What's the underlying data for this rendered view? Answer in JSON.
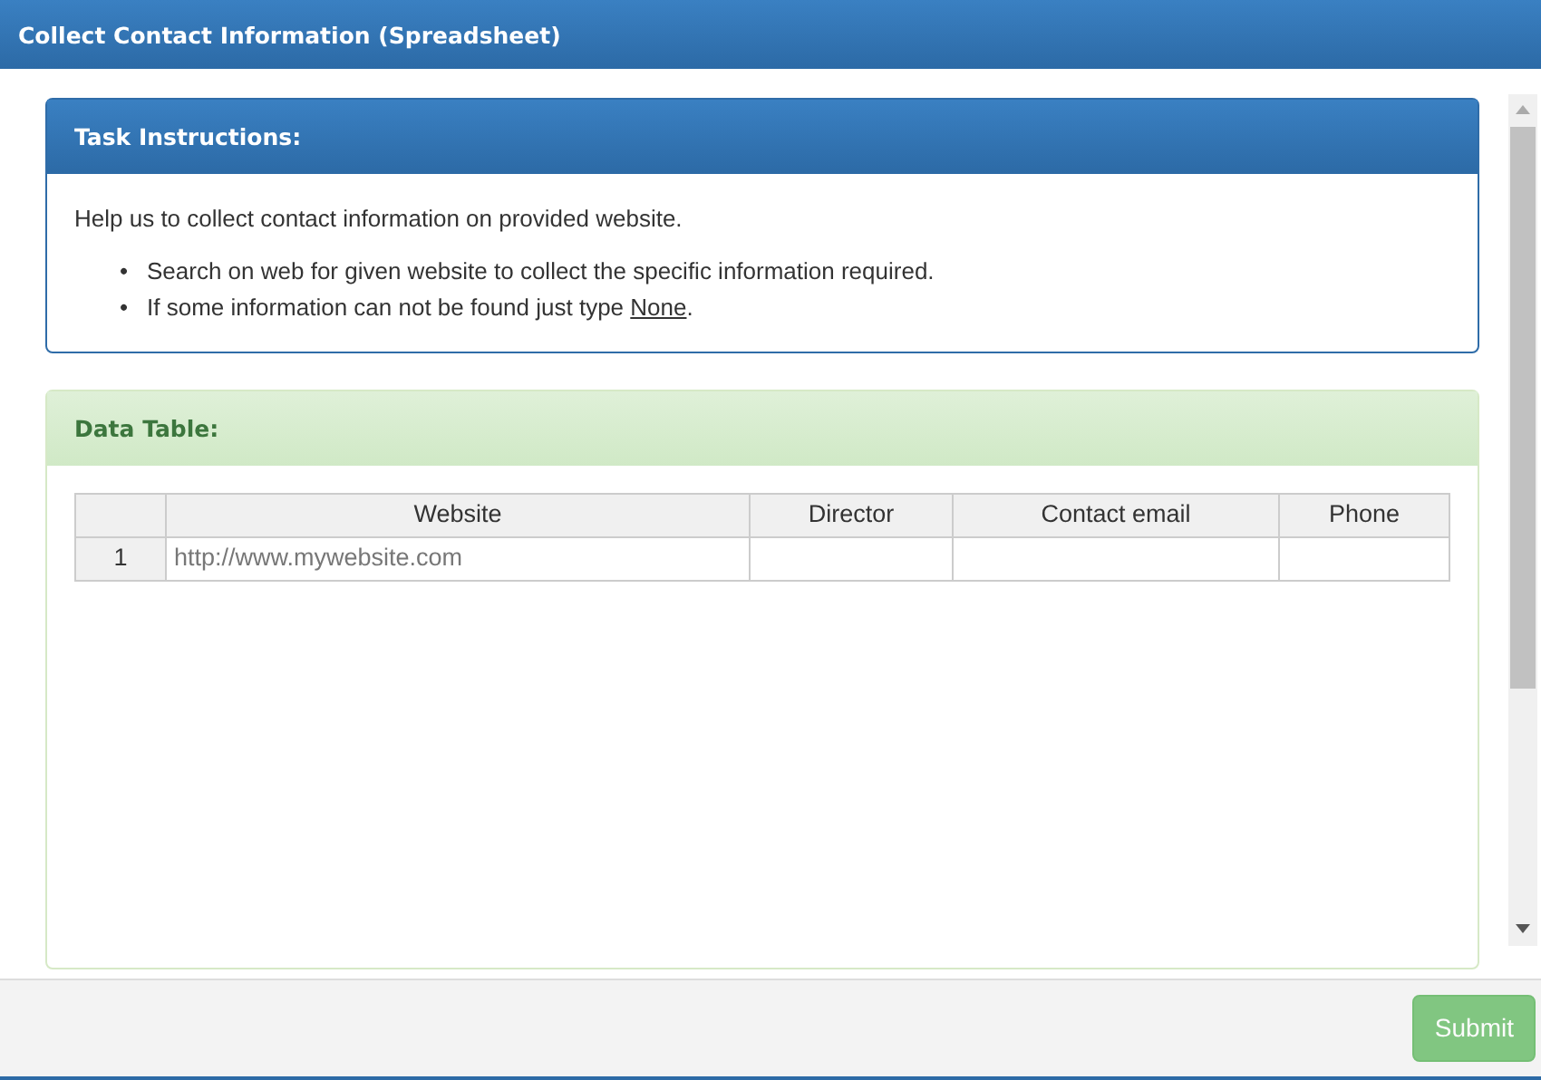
{
  "window": {
    "title": "Collect Contact Information (Spreadsheet)"
  },
  "instructions": {
    "heading": "Task Instructions:",
    "intro": "Help us to collect contact information on provided website.",
    "bullets": [
      {
        "marker": "•",
        "text": "Search on web for given website to collect the specific information required."
      },
      {
        "marker": "•",
        "text": "If some information can not be found just type ",
        "underlined": "None",
        "tail": "."
      }
    ]
  },
  "data_table": {
    "heading": "Data Table:",
    "columns": [
      "",
      "Website",
      "Director",
      "Contact email",
      "Phone"
    ],
    "rows": [
      [
        "1",
        "http://www.mywebsite.com",
        "",
        "",
        ""
      ]
    ]
  },
  "footer": {
    "submit": {
      "label": "Submit",
      "disabled": true
    }
  }
}
